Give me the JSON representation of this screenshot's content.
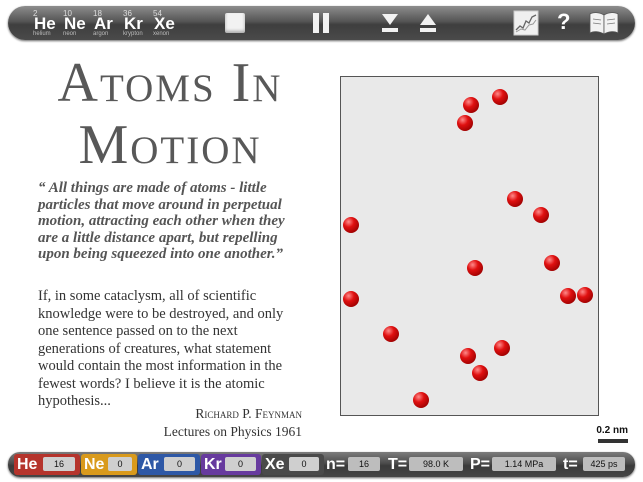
{
  "toolbar": {
    "elements": [
      {
        "number": "2",
        "symbol": "He",
        "name": "helium"
      },
      {
        "number": "10",
        "symbol": "Ne",
        "name": "neon"
      },
      {
        "number": "18",
        "symbol": "Ar",
        "name": "argon"
      },
      {
        "number": "36",
        "symbol": "Kr",
        "name": "krypton"
      },
      {
        "number": "54",
        "symbol": "Xe",
        "name": "xenon"
      }
    ],
    "icons": [
      "stop-icon",
      "pause-icon",
      "cool-down-icon",
      "heat-up-icon",
      "graph-icon",
      "help-icon",
      "book-icon"
    ],
    "help_label": "?"
  },
  "title": {
    "line1": "Atoms In",
    "line2": "Motion"
  },
  "quote": "“ All things are made of atoms - little particles that move around in perpetual motion, attracting each other when they are a little distance apart, but repelling upon being squeezed into one another.”",
  "body": "If, in some cataclysm, all of scientific knowledge were to be destroyed, and only one sentence passed on to the next generations of creatures, what statement would contain the most information in the fewest words?  I believe it is the atomic hypothesis...",
  "attribution": {
    "author": "Richard P. Feynman",
    "source": "Lectures on Physics 1961"
  },
  "simulation": {
    "atom_count": 16,
    "atom_color": "#d41010",
    "scale_label": "0.2 nm"
  },
  "status": {
    "counts": [
      {
        "symbol": "He",
        "value": "16",
        "color": "#c0362c"
      },
      {
        "symbol": "Ne",
        "value": "0",
        "color": "#e0a020"
      },
      {
        "symbol": "Ar",
        "value": "0",
        "color": "#2e5aa8"
      },
      {
        "symbol": "Kr",
        "value": "0",
        "color": "#6a3aa0"
      },
      {
        "symbol": "Xe",
        "value": "0",
        "color": "#4a4a4a"
      }
    ],
    "n_label": "n=",
    "n_value": "16",
    "T_label": "T=",
    "T_value": "98.0 K",
    "P_label": "P=",
    "P_value": "1.14 MPa",
    "t_label": "t=",
    "t_value": "425 ps"
  }
}
